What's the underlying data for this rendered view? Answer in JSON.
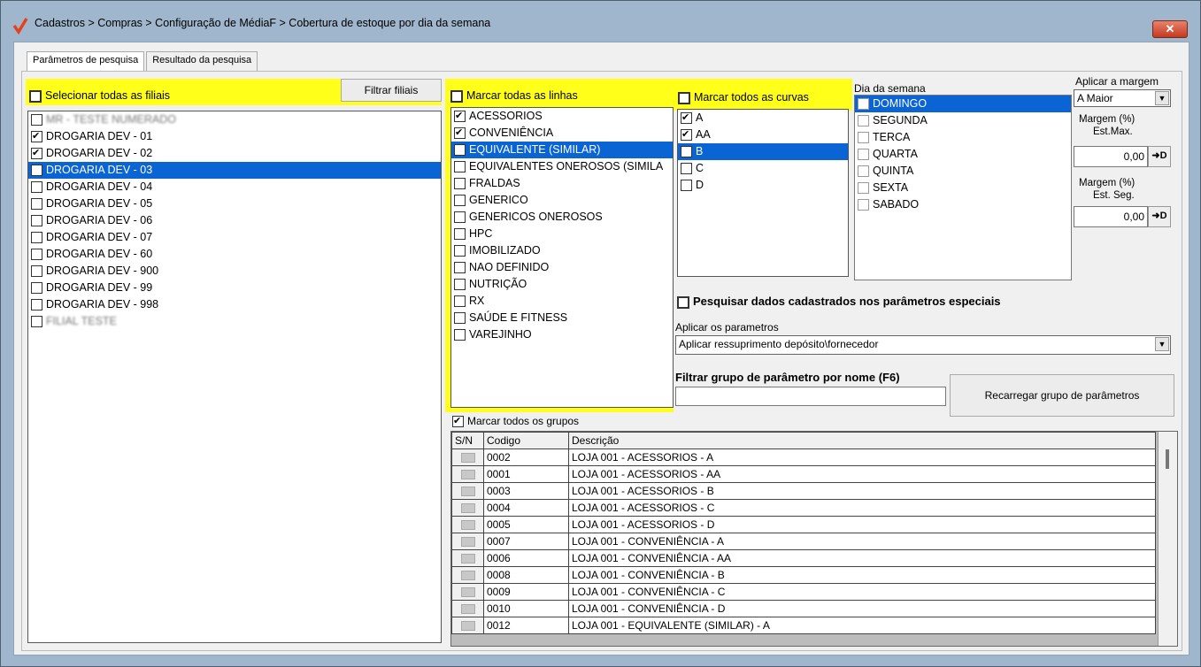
{
  "window": {
    "title": "Cadastros > Compras > Configuração de MédiaF > Cobertura de estoque por dia da semana",
    "close_label": "✕"
  },
  "tabs": [
    {
      "label": "Parâmetros de pesquisa",
      "active": true
    },
    {
      "label": "Resultado da pesquisa",
      "active": false
    }
  ],
  "filiais": {
    "select_all_label": "Selecionar todas as filiais",
    "filter_button": "Filtrar filiais",
    "items": [
      {
        "label": "MR - TESTE NUMERADO",
        "checked": false,
        "selected": false,
        "blurred": true
      },
      {
        "label": "DROGARIA DEV - 01",
        "checked": true,
        "selected": false
      },
      {
        "label": "DROGARIA DEV - 02",
        "checked": true,
        "selected": false
      },
      {
        "label": "DROGARIA DEV - 03",
        "checked": true,
        "selected": true
      },
      {
        "label": "DROGARIA DEV - 04",
        "checked": false,
        "selected": false
      },
      {
        "label": "DROGARIA DEV - 05",
        "checked": false,
        "selected": false
      },
      {
        "label": "DROGARIA DEV - 06",
        "checked": false,
        "selected": false
      },
      {
        "label": "DROGARIA DEV - 07",
        "checked": false,
        "selected": false
      },
      {
        "label": "DROGARIA DEV - 60",
        "checked": false,
        "selected": false
      },
      {
        "label": "DROGARIA DEV - 900",
        "checked": false,
        "selected": false
      },
      {
        "label": "DROGARIA DEV - 99",
        "checked": false,
        "selected": false
      },
      {
        "label": "DROGARIA DEV - 998",
        "checked": false,
        "selected": false
      },
      {
        "label": "FILIAL TESTE",
        "checked": false,
        "selected": false,
        "blurred": true
      }
    ]
  },
  "linhas": {
    "select_all_label": "Marcar todas as linhas",
    "items": [
      {
        "label": "ACESSORIOS",
        "checked": true,
        "selected": false
      },
      {
        "label": "CONVENIÊNCIA",
        "checked": true,
        "selected": false
      },
      {
        "label": "EQUIVALENTE (SIMILAR)",
        "checked": true,
        "selected": true
      },
      {
        "label": "EQUIVALENTES ONEROSOS (SIMILA",
        "checked": false,
        "selected": false
      },
      {
        "label": "FRALDAS",
        "checked": false,
        "selected": false
      },
      {
        "label": "GENERICO",
        "checked": false,
        "selected": false
      },
      {
        "label": "GENERICOS ONEROSOS",
        "checked": false,
        "selected": false
      },
      {
        "label": "HPC",
        "checked": false,
        "selected": false
      },
      {
        "label": "IMOBILIZADO",
        "checked": false,
        "selected": false
      },
      {
        "label": "NAO DEFINIDO",
        "checked": false,
        "selected": false
      },
      {
        "label": "NUTRIÇÃO",
        "checked": false,
        "selected": false
      },
      {
        "label": "RX",
        "checked": false,
        "selected": false
      },
      {
        "label": "SAÚDE E FITNESS",
        "checked": false,
        "selected": false
      },
      {
        "label": "VAREJINHO",
        "checked": false,
        "selected": false
      }
    ]
  },
  "curvas": {
    "select_all_label": "Marcar todos as curvas",
    "items": [
      {
        "label": "A",
        "checked": true,
        "selected": false
      },
      {
        "label": "AA",
        "checked": true,
        "selected": false
      },
      {
        "label": "B",
        "checked": true,
        "selected": true
      },
      {
        "label": "C",
        "checked": false,
        "selected": false
      },
      {
        "label": "D",
        "checked": false,
        "selected": false
      }
    ]
  },
  "dias": {
    "label": "Dia da semana",
    "items": [
      {
        "label": "DOMINGO",
        "selected": true
      },
      {
        "label": "SEGUNDA",
        "selected": false
      },
      {
        "label": "TERCA",
        "selected": false
      },
      {
        "label": "QUARTA",
        "selected": false
      },
      {
        "label": "QUINTA",
        "selected": false
      },
      {
        "label": "SEXTA",
        "selected": false
      },
      {
        "label": "SABADO",
        "selected": false
      }
    ]
  },
  "margem": {
    "aplicar_label": "Aplicar a margem",
    "aplicar_value": "A Maior",
    "est_max_label_1": "Margem (%)",
    "est_max_label_2": "Est.Max.",
    "est_max_value": "0,00",
    "est_seg_label_1": "Margem (%)",
    "est_seg_label_2": "Est. Seg.",
    "est_seg_value": "0,00",
    "spin_label": "➜D"
  },
  "especiais": {
    "checkbox_label": "Pesquisar dados cadastrados nos parâmetros especiais",
    "aplicar_label": "Aplicar os parametros",
    "aplicar_value": "Aplicar ressuprimento depósito\\fornecedor",
    "filtro_label": "Filtrar grupo de parâmetro por nome (F6)",
    "filtro_value": "",
    "reload_button": "Recarregar grupo de parâmetros"
  },
  "grupos": {
    "select_all_label": "Marcar todos os grupos",
    "columns": [
      "S/N",
      "Codigo",
      "Descrição"
    ],
    "rows": [
      {
        "codigo": "0002",
        "descricao": "LOJA 001 - ACESSORIOS - A"
      },
      {
        "codigo": "0001",
        "descricao": "LOJA 001 - ACESSORIOS - AA"
      },
      {
        "codigo": "0003",
        "descricao": "LOJA 001 - ACESSORIOS - B"
      },
      {
        "codigo": "0004",
        "descricao": "LOJA 001 - ACESSORIOS - C"
      },
      {
        "codigo": "0005",
        "descricao": "LOJA 001 - ACESSORIOS - D"
      },
      {
        "codigo": "0007",
        "descricao": "LOJA 001 - CONVENIÊNCIA - A"
      },
      {
        "codigo": "0006",
        "descricao": "LOJA 001 - CONVENIÊNCIA - AA"
      },
      {
        "codigo": "0008",
        "descricao": "LOJA 001 - CONVENIÊNCIA - B"
      },
      {
        "codigo": "0009",
        "descricao": "LOJA 001 - CONVENIÊNCIA - C"
      },
      {
        "codigo": "0010",
        "descricao": "LOJA 001 - CONVENIÊNCIA - D"
      },
      {
        "codigo": "0012",
        "descricao": "LOJA 001 - EQUIVALENTE (SIMILAR) - A"
      }
    ]
  }
}
